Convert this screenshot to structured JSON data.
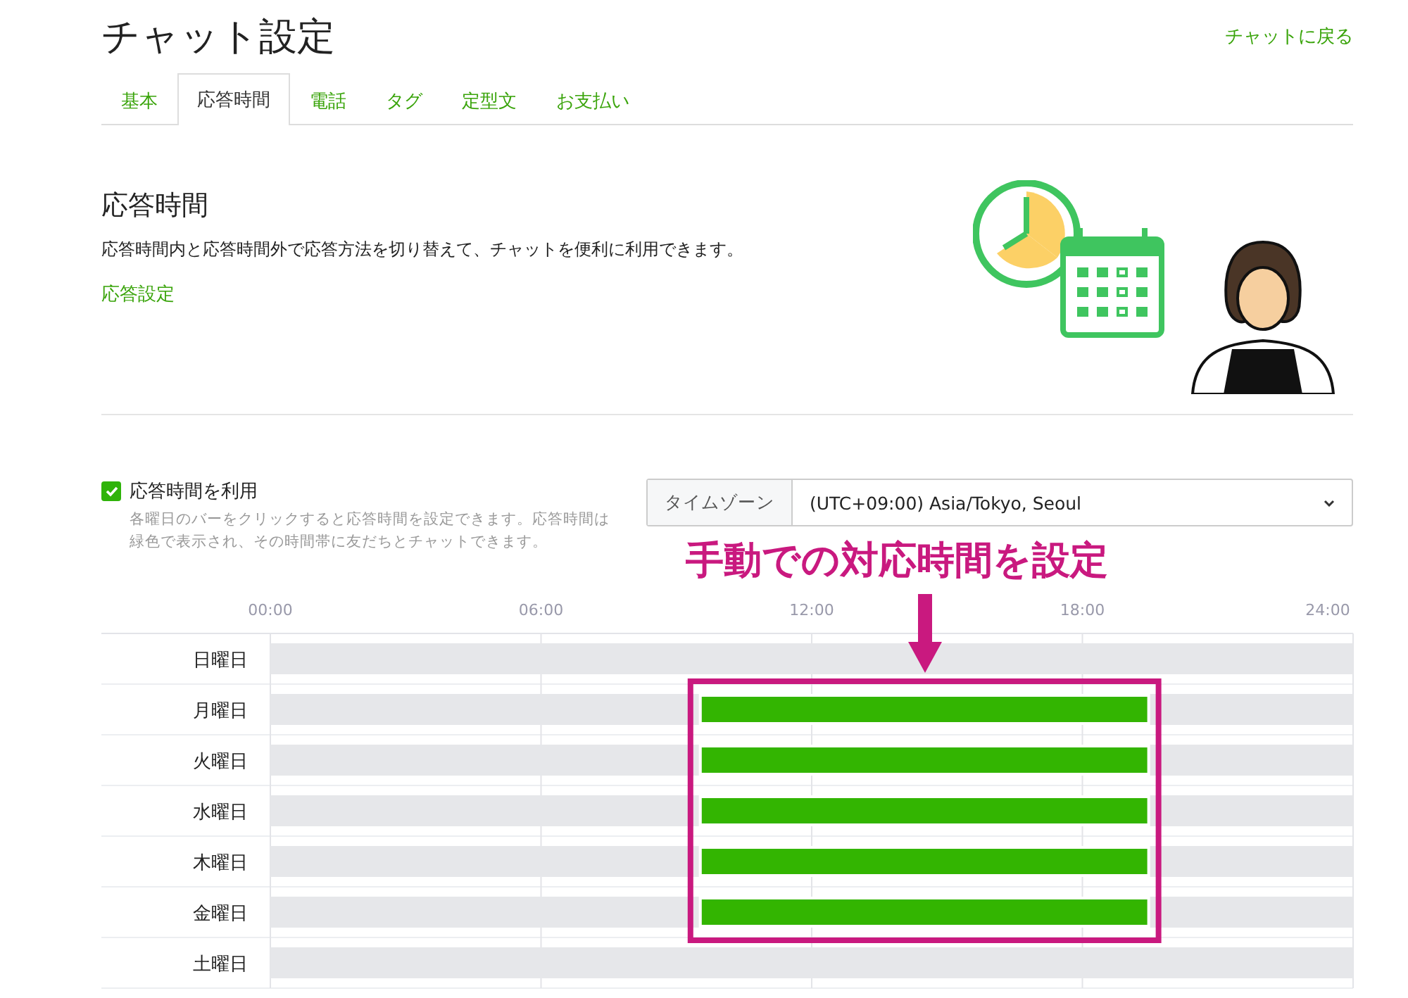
{
  "page": {
    "title": "チャット設定",
    "back_link": "チャットに戻る"
  },
  "tabs": [
    {
      "label": "基本",
      "selected": false
    },
    {
      "label": "応答時間",
      "selected": true
    },
    {
      "label": "電話",
      "selected": false
    },
    {
      "label": "タグ",
      "selected": false
    },
    {
      "label": "定型文",
      "selected": false
    },
    {
      "label": "お支払い",
      "selected": false
    }
  ],
  "section": {
    "heading": "応答時間",
    "description": "応答時間内と応答時間外で応答方法を切り替えて、チャットを便利に利用できます。",
    "link": "応答設定"
  },
  "use_hours": {
    "label": "応答時間を利用",
    "checked": true,
    "help": "各曜日のバーをクリックすると応答時間を設定できます。応答時間は緑色で表示され、その時間帯に友だちとチャットできます。"
  },
  "timezone": {
    "label": "タイムゾーン",
    "value": "(UTC+09:00) Asia/Tokyo, Seoul"
  },
  "annotation": {
    "text": "手動での対応時間を設定"
  },
  "schedule": {
    "chart_data": {
      "type": "bar",
      "orientation": "horizontal",
      "stacked": true,
      "categories": [
        "日曜日",
        "月曜日",
        "火曜日",
        "水曜日",
        "木曜日",
        "金曜日",
        "土曜日"
      ],
      "xlim": [
        0,
        24
      ],
      "xticks": [
        {
          "value": 0,
          "label": "00:00"
        },
        {
          "value": 6,
          "label": "06:00"
        },
        {
          "value": 12,
          "label": "12:00"
        },
        {
          "value": 18,
          "label": "18:00"
        },
        {
          "value": 24,
          "label": "24:00"
        }
      ],
      "grid": true,
      "series": [
        {
          "color": "#e6e7ea",
          "values": [
            24,
            9.5,
            9.5,
            9.5,
            9.5,
            9.5,
            24
          ]
        },
        {
          "color": "#33b501",
          "values": [
            null,
            10,
            10,
            10,
            10,
            10,
            null
          ]
        },
        {
          "color": "#e6e7ea",
          "values": [
            null,
            4.5,
            4.5,
            4.5,
            4.5,
            4.5,
            null
          ]
        }
      ]
    }
  }
}
